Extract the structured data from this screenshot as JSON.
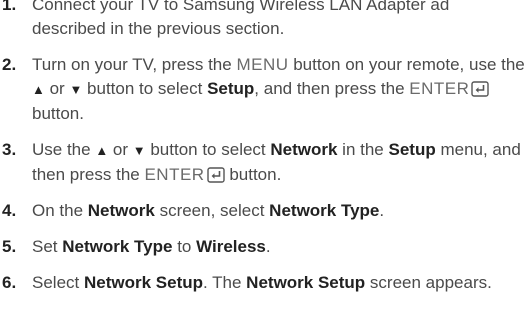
{
  "steps": [
    {
      "num": "1.",
      "text": "Connect your TV to Samsung Wireless LAN Adapter ad described in the previous section."
    },
    {
      "num": "2.",
      "t1": "Turn on your TV, press the ",
      "menu": "MENU",
      "t2": " button on your remote, use the ",
      "up": "▲",
      "t3": " or ",
      "down": "▼",
      "t4": " button to select ",
      "setup": "Setup",
      "t5": ", and then press the ",
      "enter": "ENTER",
      "t6": " button."
    },
    {
      "num": "3.",
      "t1": "Use the ",
      "up": "▲",
      "t2": " or ",
      "down": "▼",
      "t3": " button to select ",
      "network": "Network",
      "t4": " in the ",
      "setup": "Setup",
      "t5": " menu, and then press the ",
      "enter": "ENTER",
      "t6": " button."
    },
    {
      "num": "4.",
      "t1": "On the ",
      "network": "Network",
      "t2": " screen, select ",
      "network_type": "Network Type",
      "t3": "."
    },
    {
      "num": "5.",
      "t1": "Set ",
      "network_type": "Network Type",
      "t2": " to ",
      "wireless": "Wireless",
      "t3": "."
    },
    {
      "num": "6.",
      "t1": "Select ",
      "network_setup": "Network Setup",
      "t2": ". The ",
      "network_setup_2": "Network Setup",
      "t3": " screen appears."
    }
  ],
  "icons": {
    "enter": "enter-icon"
  }
}
